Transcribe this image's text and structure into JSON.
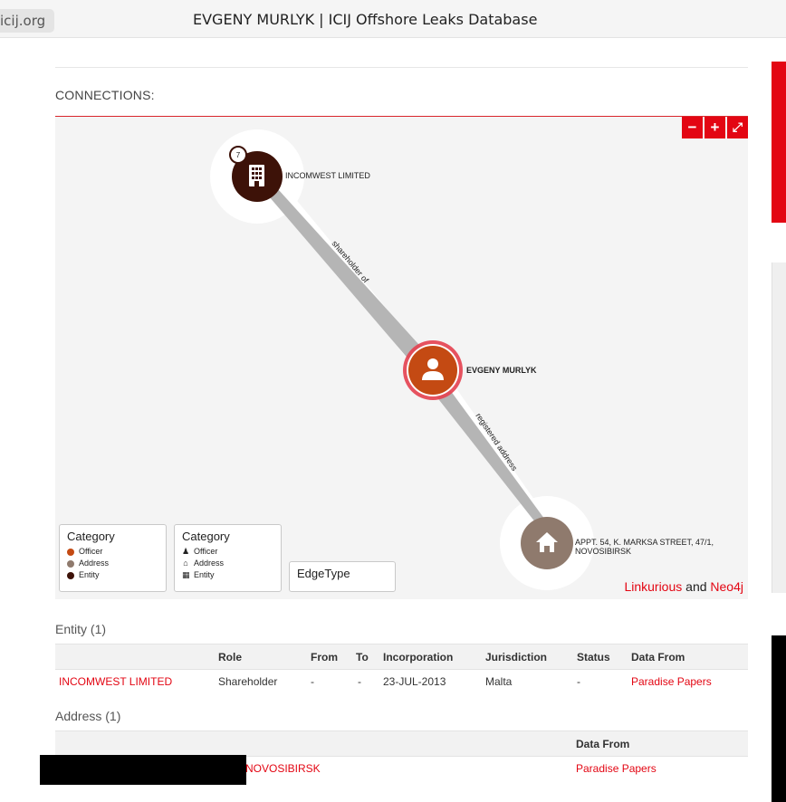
{
  "browser": {
    "domain": "icij.org",
    "title": "EVGENY MURLYK | ICIJ Offshore Leaks Database"
  },
  "connections": {
    "label": "CONNECTIONS:",
    "zoom_out": "−",
    "zoom_in": "+",
    "fullscreen": "⤢",
    "nodes": {
      "entity": {
        "label": "INCOMWEST LIMITED",
        "badge": "7",
        "color": "#3d1208"
      },
      "officer": {
        "label": "EVGENY MURLYK",
        "color": "#c44a13"
      },
      "address": {
        "label_line1": "APPT. 54, K. MARKSA STREET, 47/1,",
        "label_line2": "NOVOSIBIRSK",
        "color": "#8f7a6d"
      }
    },
    "edges": {
      "shareholder": "shareholder of",
      "registered": "registered address"
    },
    "legend_color": {
      "title": "Category",
      "items": [
        {
          "label": "Officer",
          "color": "#c44a13"
        },
        {
          "label": "Address",
          "color": "#8f7a6d"
        },
        {
          "label": "Entity",
          "color": "#3d1208"
        }
      ]
    },
    "legend_icon": {
      "title": "Category",
      "items": [
        {
          "label": "Officer",
          "glyph": "♟"
        },
        {
          "label": "Address",
          "glyph": "⌂"
        },
        {
          "label": "Entity",
          "glyph": "▦"
        }
      ]
    },
    "legend_edge": {
      "title": "EdgeType"
    },
    "credits": {
      "linkurious": "Linkurious",
      "and": " and ",
      "neo4j": "Neo4j"
    }
  },
  "entity_section": {
    "title": "Entity (1)",
    "headers": [
      "Role",
      "From",
      "To",
      "Incorporation",
      "Jurisdiction",
      "Status",
      "Data From"
    ],
    "row": {
      "name": "INCOMWEST LIMITED",
      "role": "Shareholder",
      "from": "-",
      "to": "-",
      "incorporation": "23-JUL-2013",
      "jurisdiction": "Malta",
      "status": "-",
      "data_from": "Paradise Papers"
    }
  },
  "address_section": {
    "title": "Address (1)",
    "headers": [
      "Data From"
    ],
    "row": {
      "address_visible": "NOVOSIBIRSK",
      "data_from": "Paradise Papers"
    }
  }
}
